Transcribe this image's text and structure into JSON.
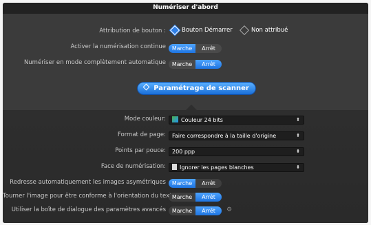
{
  "title": "Numériser d'abord",
  "button_assignment": {
    "label": "Attribution de bouton :",
    "options": [
      "Bouton Démarrer",
      "Non attribué"
    ],
    "selected": "Bouton Démarrer"
  },
  "continuous_scan": {
    "label": "Activer la numérisation continue",
    "on": "Marche",
    "off": "Arrêt",
    "value": "Marche"
  },
  "auto_mode": {
    "label": "Numériser en mode complètement automatique",
    "on": "Marche",
    "off": "Arrêt",
    "value": "Arrêt"
  },
  "scanner_settings_button": "Paramétrage de scanner",
  "color_mode": {
    "label": "Mode couleur:",
    "value": "Couleur 24 bits"
  },
  "page_format": {
    "label": "Format de page:",
    "value": "Faire correspondre à la taille d'origine"
  },
  "dpi": {
    "label": "Points par pouce:",
    "value": "200 ppp"
  },
  "scan_side": {
    "label": "Face de numérisation:",
    "value": "Ignorer les pages blanches"
  },
  "deskew": {
    "label": "Redresse automatiquement les images asymétriques",
    "on": "Marche",
    "off": "Arrêt",
    "value": "Marche"
  },
  "rotate": {
    "label": "Tourner l'image pour être conforme à l'orientation du texte",
    "on": "Marche",
    "off": "Arrêt",
    "value": "Arrêt"
  },
  "advanced": {
    "label": "Utiliser la boîte de dialogue des paramètres avancés",
    "on": "Marche",
    "off": "Arrêt",
    "value": "Arrêt"
  },
  "colors": {
    "accent": "#2f80e8",
    "panel": "#3a3a3a",
    "dark": "#2a2a2a"
  },
  "icons": {
    "selects_arrow": "up-down-arrows-icon",
    "gear": "gear-icon"
  }
}
